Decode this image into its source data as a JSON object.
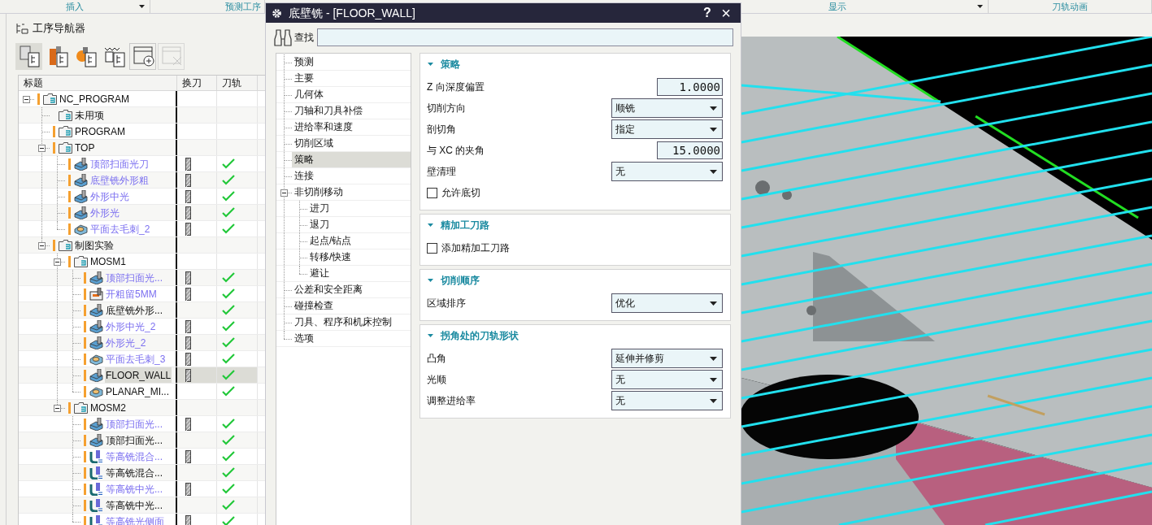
{
  "ribbon_groups": [
    {
      "label": "插入",
      "has_menu": true
    },
    {
      "label": "预测工序",
      "has_menu": false
    },
    {
      "label": "显示",
      "has_menu": true
    },
    {
      "label": "刀轨动画",
      "has_menu": false
    }
  ],
  "navigator": {
    "title": "工序导航器",
    "toolbar": [
      {
        "kind": "program_view",
        "selected": true,
        "disabled": false
      },
      {
        "kind": "tool_view",
        "selected": false,
        "disabled": false
      },
      {
        "kind": "geometry_view",
        "selected": false,
        "disabled": false
      },
      {
        "kind": "method_view",
        "selected": false,
        "disabled": false
      },
      {
        "kind": "add",
        "selected": false,
        "disabled": false
      },
      {
        "kind": "remove",
        "selected": false,
        "disabled": true
      }
    ],
    "columns": [
      "标题",
      "换刀",
      "刀轨"
    ],
    "tree": [
      {
        "label": "NC_PROGRAM",
        "kind": "folder",
        "flag": true,
        "changed": false,
        "tool_change": false,
        "toolpath": false,
        "selected": false,
        "expanded": true,
        "children": [
          {
            "label": "未用项",
            "kind": "folder",
            "flag": false,
            "changed": false,
            "tool_change": false,
            "toolpath": false,
            "selected": false
          },
          {
            "label": "PROGRAM",
            "kind": "folder",
            "flag": true,
            "changed": false,
            "tool_change": false,
            "toolpath": false,
            "selected": false
          },
          {
            "label": "TOP",
            "kind": "folder",
            "flag": true,
            "changed": false,
            "tool_change": false,
            "toolpath": false,
            "selected": false,
            "expanded": true,
            "children": [
              {
                "label": "顶部扫面光刀",
                "kind": "floor_wall",
                "flag": true,
                "changed": true,
                "tool_change": true,
                "toolpath": true,
                "selected": false
              },
              {
                "label": "底壁铣外形粗",
                "kind": "floor_wall",
                "flag": true,
                "changed": true,
                "tool_change": true,
                "toolpath": true,
                "selected": false
              },
              {
                "label": "外形中光",
                "kind": "floor_wall",
                "flag": true,
                "changed": true,
                "tool_change": true,
                "toolpath": true,
                "selected": false
              },
              {
                "label": "外形光",
                "kind": "floor_wall",
                "flag": true,
                "changed": true,
                "tool_change": true,
                "toolpath": true,
                "selected": false
              },
              {
                "label": "平面去毛刺_2",
                "kind": "deburr",
                "flag": true,
                "changed": true,
                "tool_change": true,
                "toolpath": true,
                "selected": false
              }
            ]
          },
          {
            "label": "制图实验",
            "kind": "folder",
            "flag": true,
            "changed": false,
            "tool_change": false,
            "toolpath": false,
            "selected": false,
            "expanded": true,
            "children": [
              {
                "label": "MOSM1",
                "kind": "folder",
                "flag": true,
                "changed": false,
                "tool_change": false,
                "toolpath": false,
                "selected": false,
                "expanded": true,
                "children": [
                  {
                    "label": "顶部扫面光...",
                    "kind": "floor_wall",
                    "flag": true,
                    "changed": true,
                    "tool_change": true,
                    "toolpath": true,
                    "selected": false
                  },
                  {
                    "label": "开粗留5MM",
                    "kind": "cavity",
                    "flag": true,
                    "changed": true,
                    "tool_change": true,
                    "toolpath": true,
                    "selected": false
                  },
                  {
                    "label": "底壁铣外形...",
                    "kind": "floor_wall",
                    "flag": true,
                    "changed": false,
                    "tool_change": false,
                    "toolpath": true,
                    "selected": false
                  },
                  {
                    "label": "外形中光_2",
                    "kind": "floor_wall",
                    "flag": true,
                    "changed": true,
                    "tool_change": true,
                    "toolpath": true,
                    "selected": false
                  },
                  {
                    "label": "外形光_2",
                    "kind": "floor_wall",
                    "flag": true,
                    "changed": true,
                    "tool_change": true,
                    "toolpath": true,
                    "selected": false
                  },
                  {
                    "label": "平面去毛刺_3",
                    "kind": "deburr",
                    "flag": true,
                    "changed": true,
                    "tool_change": true,
                    "toolpath": true,
                    "selected": false
                  },
                  {
                    "label": "FLOOR_WALL",
                    "kind": "floor_wall",
                    "flag": true,
                    "changed": false,
                    "tool_change": true,
                    "toolpath": true,
                    "selected": true
                  },
                  {
                    "label": "PLANAR_MI...",
                    "kind": "deburr",
                    "flag": true,
                    "changed": false,
                    "tool_change": false,
                    "toolpath": true,
                    "selected": false
                  }
                ]
              },
              {
                "label": "MOSM2",
                "kind": "folder",
                "flag": true,
                "changed": false,
                "tool_change": false,
                "toolpath": false,
                "selected": false,
                "expanded": true,
                "children": [
                  {
                    "label": "顶部扫面光...",
                    "kind": "floor_wall",
                    "flag": true,
                    "changed": true,
                    "tool_change": true,
                    "toolpath": true,
                    "selected": false
                  },
                  {
                    "label": "顶部扫面光...",
                    "kind": "floor_wall",
                    "flag": true,
                    "changed": false,
                    "tool_change": false,
                    "toolpath": true,
                    "selected": false
                  },
                  {
                    "label": "等高铣混合...",
                    "kind": "zlevel",
                    "flag": true,
                    "changed": true,
                    "tool_change": true,
                    "toolpath": true,
                    "selected": false
                  },
                  {
                    "label": "等高铣混合...",
                    "kind": "zlevel",
                    "flag": true,
                    "changed": false,
                    "tool_change": false,
                    "toolpath": true,
                    "selected": false
                  },
                  {
                    "label": "等高铣中光...",
                    "kind": "zlevel",
                    "flag": true,
                    "changed": true,
                    "tool_change": true,
                    "toolpath": true,
                    "selected": false
                  },
                  {
                    "label": "等高铣中光...",
                    "kind": "zlevel",
                    "flag": true,
                    "changed": false,
                    "tool_change": false,
                    "toolpath": true,
                    "selected": false
                  },
                  {
                    "label": "等高铣光侧面",
                    "kind": "zlevel",
                    "flag": true,
                    "changed": true,
                    "tool_change": true,
                    "toolpath": true,
                    "selected": false
                  }
                ]
              }
            ]
          }
        ]
      }
    ]
  },
  "dialog": {
    "title": "底壁铣 - [FLOOR_WALL]",
    "help": "?",
    "close": "×",
    "search_label": "查找",
    "nav": [
      {
        "label": "预测",
        "selected": false
      },
      {
        "label": "主要",
        "selected": false
      },
      {
        "label": "几何体",
        "selected": false
      },
      {
        "label": "刀轴和刀具补偿",
        "selected": false
      },
      {
        "label": "进给率和速度",
        "selected": false
      },
      {
        "label": "切削区域",
        "selected": false
      },
      {
        "label": "策略",
        "selected": true
      },
      {
        "label": "连接",
        "selected": false
      },
      {
        "label": "非切削移动",
        "selected": false,
        "expanded": true,
        "children": [
          {
            "label": "进刀",
            "selected": false
          },
          {
            "label": "退刀",
            "selected": false
          },
          {
            "label": "起点/钻点",
            "selected": false
          },
          {
            "label": "转移/快速",
            "selected": false
          },
          {
            "label": "避让",
            "selected": false
          }
        ]
      },
      {
        "label": "公差和安全距离",
        "selected": false
      },
      {
        "label": "碰撞检查",
        "selected": false
      },
      {
        "label": "刀具、程序和机床控制",
        "selected": false
      },
      {
        "label": "选项",
        "selected": false
      }
    ],
    "sections": [
      {
        "title": "策略",
        "expanded": true,
        "rows": [
          {
            "kind": "number",
            "label": "Z 向深度偏置",
            "value": "1.0000"
          },
          {
            "kind": "select",
            "label": "切削方向",
            "value": "顺铣"
          },
          {
            "kind": "select",
            "label": "剖切角",
            "value": "指定"
          },
          {
            "kind": "number",
            "label": "与 XC 的夹角",
            "value": "15.0000"
          },
          {
            "kind": "select",
            "label": "壁清理",
            "value": "无"
          },
          {
            "kind": "checkbox",
            "label": "允许底切",
            "checked": false
          }
        ]
      },
      {
        "title": "精加工刀路",
        "expanded": true,
        "rows": [
          {
            "kind": "checkbox",
            "label": "添加精加工刀路",
            "checked": false
          }
        ]
      },
      {
        "title": "切削顺序",
        "expanded": true,
        "rows": [
          {
            "kind": "select",
            "label": "区域排序",
            "value": "优化"
          }
        ]
      },
      {
        "title": "拐角处的刀轨形状",
        "expanded": true,
        "rows": [
          {
            "kind": "select",
            "label": "凸角",
            "value": "延伸并修剪"
          },
          {
            "kind": "select",
            "label": "光顺",
            "value": "无"
          },
          {
            "kind": "select",
            "label": "调整进给率",
            "value": "无"
          }
        ]
      }
    ]
  }
}
